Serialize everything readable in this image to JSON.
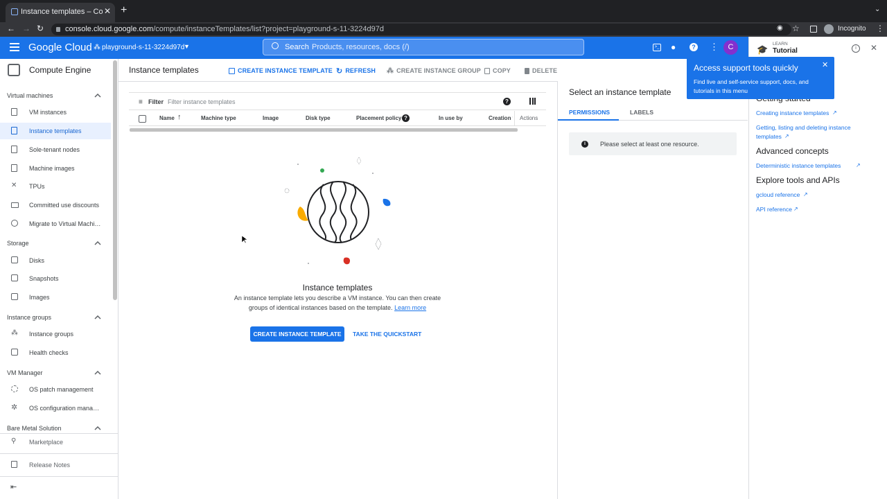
{
  "browser": {
    "tab_title": "Instance templates – Compute",
    "url_host": "console.cloud.google.com",
    "url_path": "/compute/instanceTemplates/list?project=playground-s-11-3224d97d",
    "profile_label": "Incognito"
  },
  "header": {
    "logo": "Google Cloud",
    "project": "playground-s-11-3224d97d",
    "search_label": "Search",
    "search_placeholder": "Products, resources, docs (/)",
    "avatar_letter": "C"
  },
  "sidebar": {
    "product": "Compute Engine",
    "sections": [
      {
        "title": "Virtual machines",
        "items": [
          "VM instances",
          "Instance templates",
          "Sole-tenant nodes",
          "Machine images",
          "TPUs",
          "Committed use discounts",
          "Migrate to Virtual Machin..."
        ]
      },
      {
        "title": "Storage",
        "items": [
          "Disks",
          "Snapshots",
          "Images"
        ]
      },
      {
        "title": "Instance groups",
        "items": [
          "Instance groups",
          "Health checks"
        ]
      },
      {
        "title": "VM Manager",
        "items": [
          "OS patch management",
          "OS configuration manage..."
        ]
      },
      {
        "title": "Bare Metal Solution",
        "items": []
      }
    ],
    "footer_items": [
      "Marketplace",
      "Release Notes"
    ]
  },
  "page": {
    "title": "Instance templates",
    "toolbar": {
      "create": "CREATE INSTANCE TEMPLATE",
      "refresh": "REFRESH",
      "create_group": "CREATE INSTANCE GROUP",
      "copy": "COPY",
      "delete": "DELETE"
    },
    "filter_label": "Filter",
    "filter_placeholder": "Filter instance templates",
    "columns": [
      "Name",
      "Machine type",
      "Image",
      "Disk type",
      "Placement policy",
      "In use by",
      "Creation t",
      "Actions"
    ],
    "empty_title": "Instance templates",
    "empty_desc_1": "An instance template lets you describe a VM instance. You can then create",
    "empty_desc_2": "groups of identical instances based on the template.",
    "learn_more": "Learn more",
    "create_btn": "CREATE INSTANCE TEMPLATE",
    "quickstart_btn": "TAKE THE QUICKSTART"
  },
  "info_panel": {
    "title": "Select an instance template",
    "tabs": [
      "PERMISSIONS",
      "LABELS"
    ],
    "message": "Please select at least one resource."
  },
  "tutorial": {
    "kicker": "LEARN",
    "title": "Tutorial",
    "getting_started": "Getting started",
    "links_1": [
      "Creating instance templates",
      "Getting, listing and deleting instance",
      "templates"
    ],
    "advanced": "Advanced concepts",
    "links_2": [
      "Deterministic instance templates"
    ],
    "explore": "Explore tools and APIs",
    "links_3": [
      "gcloud reference",
      "API reference"
    ]
  },
  "callout": {
    "title": "Access support tools quickly",
    "body_1": "Find live and self-service support, docs, and",
    "body_2": "tutorials in this menu"
  },
  "colors": {
    "brand_blue": "#1a73e8",
    "active_bg": "#e8f0fe",
    "chrome_dark": "#202124"
  }
}
